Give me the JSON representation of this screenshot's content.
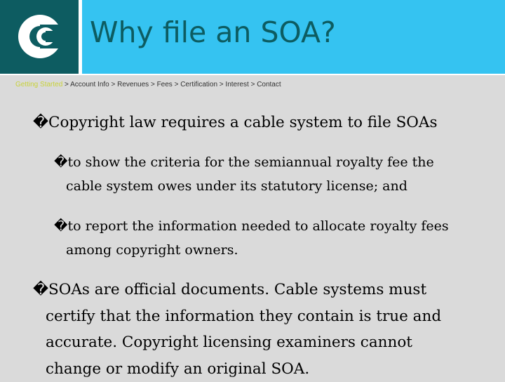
{
  "header": {
    "logo_name": "copyright-office-logo",
    "title": "Why file an SOA?",
    "colors": {
      "logo_bg": "#0d5c61",
      "title_bar_bg": "#35c3f1",
      "title_text": "#0d5c61"
    }
  },
  "breadcrumb": {
    "active": "Getting Started",
    "separator": ">",
    "items": [
      "Account Info",
      "Revenues",
      "Fees",
      "Certification",
      "Interest",
      "Contact"
    ],
    "active_color": "#c8d23a"
  },
  "content": {
    "bullet_glyph": "�",
    "bullets": [
      {
        "level": 1,
        "lines": [
          "Copyright law requires a cable system to file SOAs"
        ]
      },
      {
        "level": 2,
        "lines": [
          "to show the criteria for the semiannual royalty fee the",
          "cable system owes under its statutory license; and"
        ]
      },
      {
        "level": 2,
        "lines": [
          "to report the information needed to allocate royalty fees",
          "among copyright owners."
        ]
      },
      {
        "level": 1,
        "lines": [
          "SOAs are official documents. Cable systems must",
          "certify that the information they contain is true and",
          "accurate. Copyright licensing examiners cannot",
          "change or modify an original SOA."
        ]
      }
    ]
  }
}
